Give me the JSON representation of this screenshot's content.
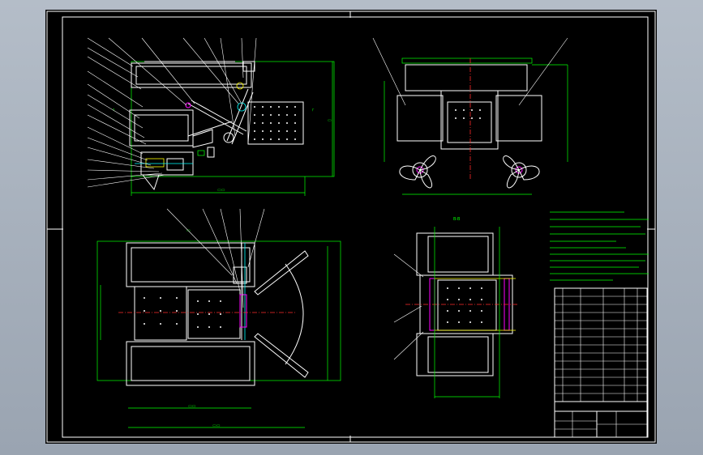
{
  "drawing": {
    "section_label": "B-B",
    "notes_lines": 11,
    "title_block_rows": 14
  },
  "colors": {
    "background": "#000000",
    "outline": "#ffffff",
    "dimension": "#00ff00",
    "centerline": "#ff2a2a",
    "frame": "#ffffff"
  }
}
